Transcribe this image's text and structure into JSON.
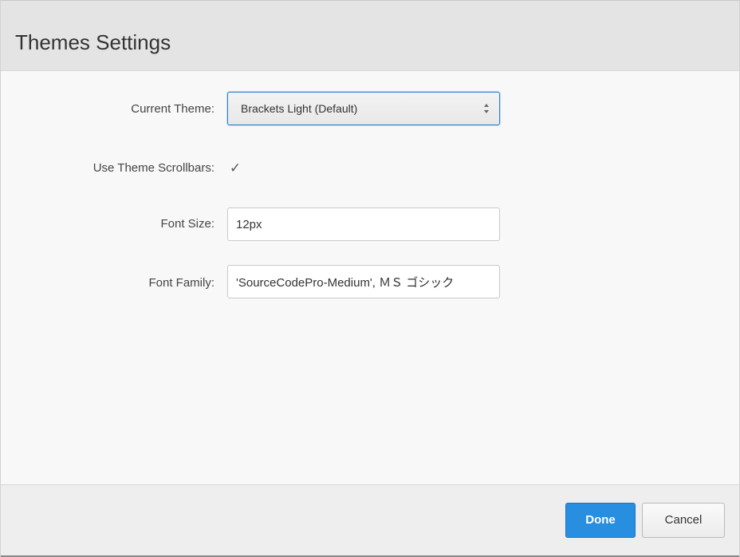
{
  "dialog": {
    "title": "Themes Settings"
  },
  "form": {
    "current_theme": {
      "label": "Current Theme:",
      "value": "Brackets Light (Default)"
    },
    "scrollbars": {
      "label": "Use Theme Scrollbars:",
      "checked": true,
      "check_glyph": "✓"
    },
    "font_size": {
      "label": "Font Size:",
      "value": "12px"
    },
    "font_family": {
      "label": "Font Family:",
      "value": "'SourceCodePro-Medium', ＭＳ ゴシック"
    }
  },
  "footer": {
    "done_label": "Done",
    "cancel_label": "Cancel"
  },
  "colors": {
    "primary_button": "#288edf",
    "focus_border": "#2b80d2",
    "header_bg": "#e4e4e4"
  },
  "icons": {
    "select_arrows": "select-arrows-icon",
    "checkmark": "checkmark-icon"
  }
}
